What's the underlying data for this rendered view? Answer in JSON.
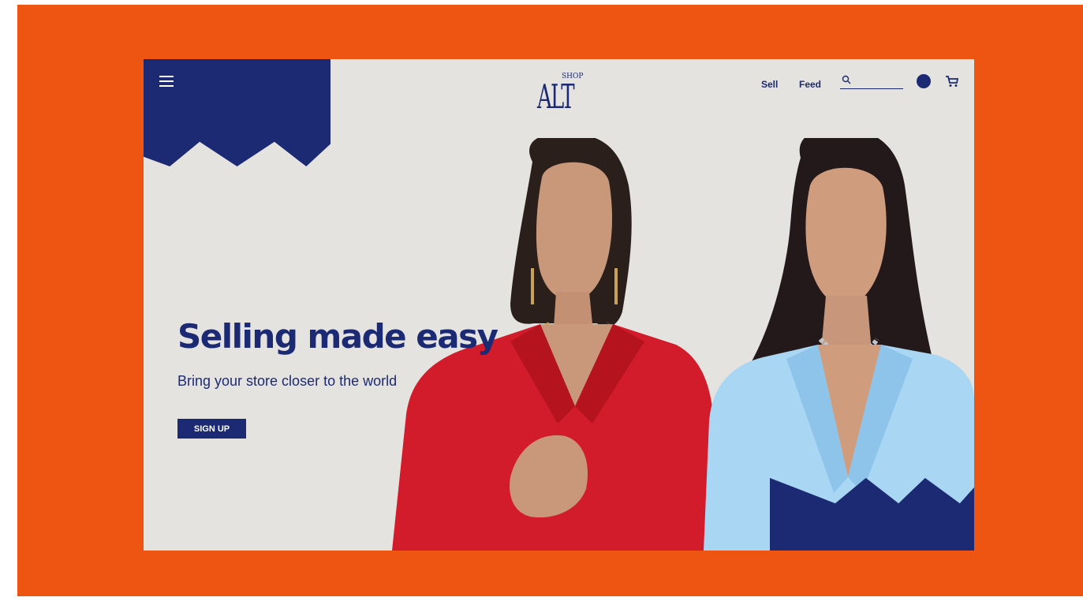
{
  "colors": {
    "frame": "#EE5412",
    "accent": "#1C2A74",
    "background": "#E5E3DF",
    "red_blazer": "#D21B2B",
    "blue_blazer": "#A9D6F3"
  },
  "header": {
    "menu_icon": "hamburger-menu-icon",
    "logo": {
      "small_text": "SHOP",
      "word": "ALT"
    },
    "nav": [
      {
        "label": "Sell"
      },
      {
        "label": "Feed"
      }
    ],
    "search": {
      "icon": "search-icon",
      "value": ""
    },
    "avatar_icon": "avatar",
    "cart_icon": "cart-icon"
  },
  "hero": {
    "headline": "Selling made easy",
    "subheadline": "Bring your store closer to the world",
    "cta_label": "SIGN UP"
  }
}
